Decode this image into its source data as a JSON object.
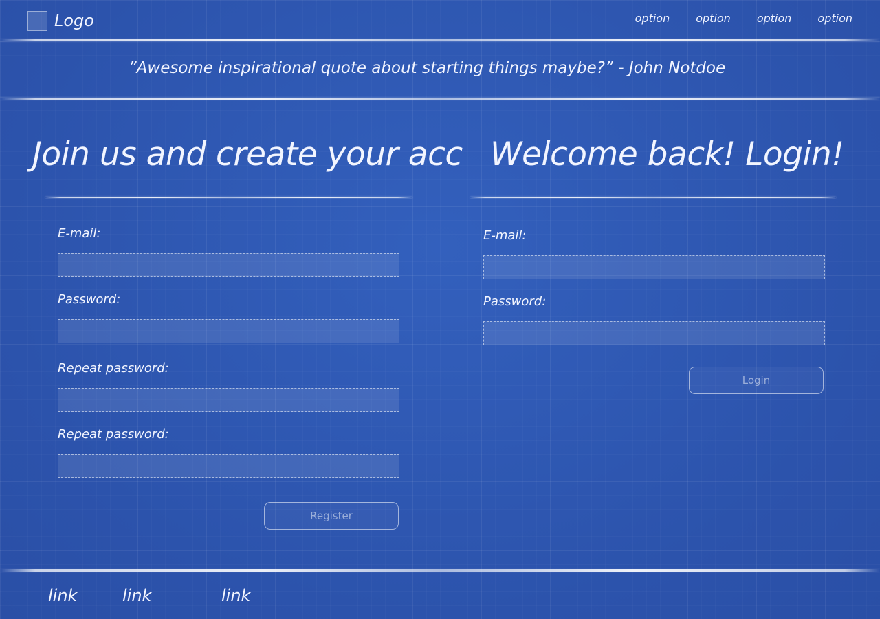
{
  "header": {
    "logo_text": "Logo",
    "nav": [
      "option",
      "option",
      "option",
      "option"
    ]
  },
  "quote": "”Awesome inspirational quote about starting things maybe?” - John Notdoe",
  "register": {
    "heading": "Join us and create your acc",
    "fields": [
      {
        "label": "E-mail:",
        "value": "",
        "placeholder": ""
      },
      {
        "label": "Password:",
        "value": "",
        "placeholder": ""
      },
      {
        "label": "Repeat password:",
        "value": "",
        "placeholder": ""
      },
      {
        "label": "Repeat password:",
        "value": "",
        "placeholder": ""
      }
    ],
    "button_label": "Register"
  },
  "login": {
    "heading": "Welcome back! Login!",
    "fields": [
      {
        "label": "E-mail:",
        "value": "",
        "placeholder": ""
      },
      {
        "label": "Password:",
        "value": "",
        "placeholder": ""
      }
    ],
    "button_label": "Login"
  },
  "footer": {
    "links": [
      "link",
      "link",
      "link"
    ]
  },
  "colors": {
    "background": "#2f57b3",
    "text": "#f2f5ff"
  }
}
